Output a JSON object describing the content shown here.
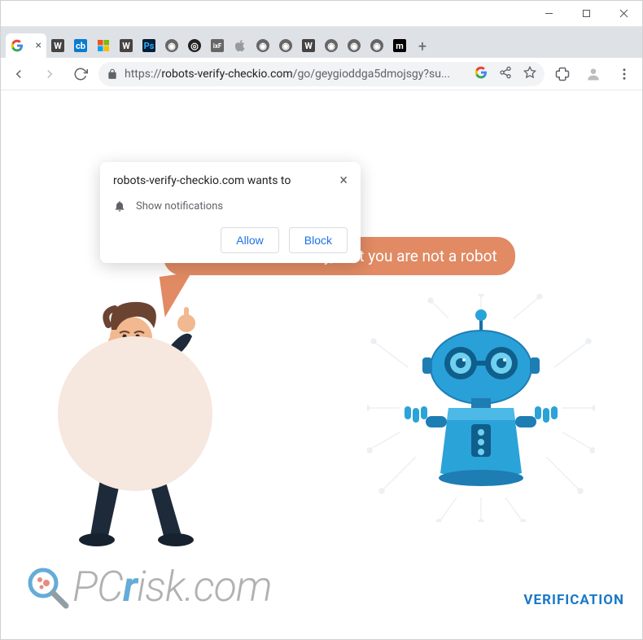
{
  "window": {
    "controls": {
      "min": "–",
      "max": "□",
      "close": "×"
    }
  },
  "tabs": {
    "active_close": "×",
    "new_tab_tooltip": "+"
  },
  "toolbar": {
    "url_proto": "https://",
    "url_host": "robots-verify-checkio.com",
    "url_path": "/go/geygioddga5dmojsgy?su..."
  },
  "permission": {
    "title": "robots-verify-checkio.com wants to",
    "label": "Show notifications",
    "allow": "Allow",
    "block": "Block",
    "close": "×"
  },
  "page": {
    "speech": "Press “Allow” to verify, that you are not a robot",
    "verification": "VERIFICATION",
    "watermark_pc": "PC",
    "watermark_r": "r",
    "watermark_rest": "isk.com"
  },
  "icons": {
    "google": "G",
    "wp": "W",
    "cb": "cb",
    "ps": "Ps",
    "ixf": "ixF",
    "apple": "",
    "mx": "m",
    "globe": "◉",
    "target": "◎"
  }
}
